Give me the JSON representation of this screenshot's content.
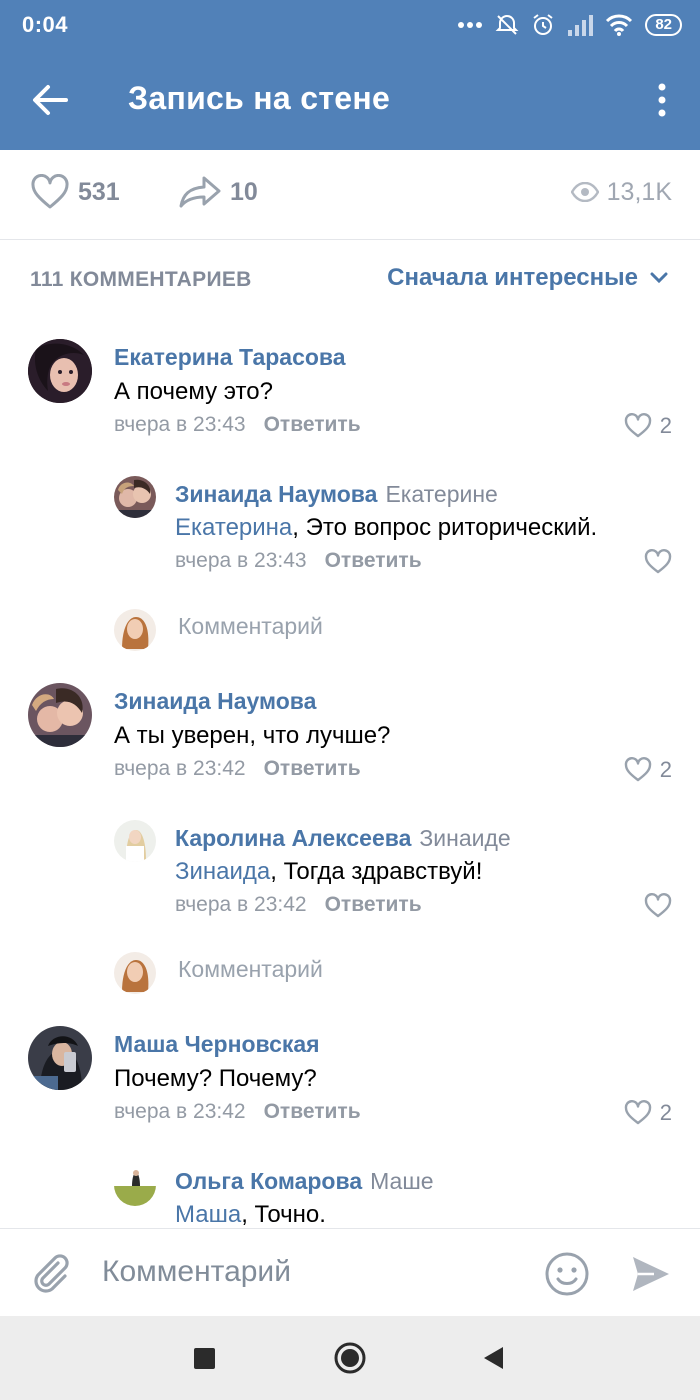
{
  "status_bar": {
    "time": "0:04",
    "battery": "82",
    "icons": [
      "more-dots-icon",
      "alarm-off-icon",
      "alarm-icon",
      "signal-icon",
      "wifi-icon",
      "battery-icon"
    ]
  },
  "header": {
    "title": "Запись на стене",
    "back_icon": "arrow-left-icon",
    "menu_icon": "more-vertical-icon"
  },
  "stats": {
    "likes": "531",
    "shares": "10",
    "views": "13,1K"
  },
  "comments_header": {
    "count_label": "111 КОММЕНТАРИЕВ",
    "sort_label": "Сначала интересные"
  },
  "comments": [
    {
      "author": "Екатерина Тарасова",
      "text": "А почему это?",
      "time": "вчера в 23:43",
      "reply_label": "Ответить",
      "likes": "2",
      "reply": {
        "author": "Зинаида Наумова",
        "to": "Екатерине",
        "mention": "Екатерина",
        "text": ", Это вопрос риторический.",
        "time": "вчера в 23:43",
        "reply_label": "Ответить"
      },
      "write_placeholder": "Комментарий"
    },
    {
      "author": "Зинаида Наумова",
      "text": "А ты уверен, что лучше?",
      "time": "вчера в 23:42",
      "reply_label": "Ответить",
      "likes": "2",
      "reply": {
        "author": "Каролина Алексеева",
        "to": "Зинаиде",
        "mention": "Зинаида",
        "text": ", Тогда здравствуй!",
        "time": "вчера в 23:42",
        "reply_label": "Ответить"
      },
      "write_placeholder": "Комментарий"
    },
    {
      "author": "Маша Черновская",
      "text": "Почему? Почему?",
      "time": "вчера в 23:42",
      "reply_label": "Ответить",
      "likes": "2",
      "reply": {
        "author": "Ольга Комарова",
        "to": "Маше",
        "mention": "Маша",
        "text": ", Точно."
      }
    }
  ],
  "composer": {
    "placeholder": "Комментарий"
  },
  "colors": {
    "brand": "#5181b8",
    "link": "#4a76a8",
    "muted": "#828a99"
  }
}
